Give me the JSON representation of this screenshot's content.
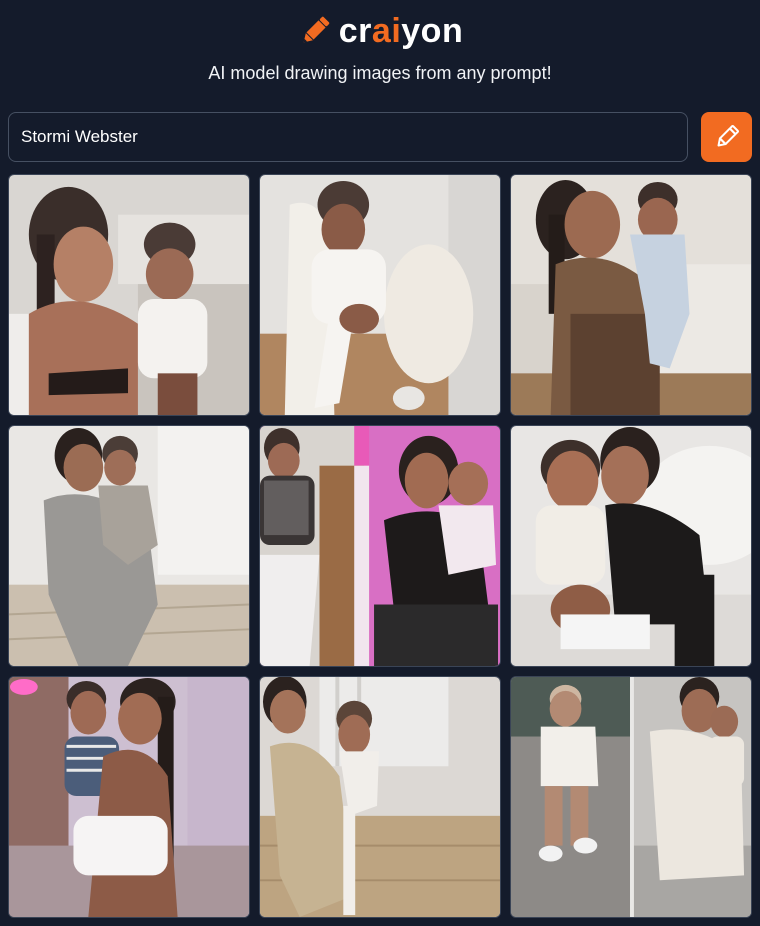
{
  "brand": {
    "logo_prefix": "cr",
    "logo_ai": "ai",
    "logo_suffix": "yon",
    "tagline": "AI model drawing images from any prompt!",
    "accent_color": "#f26b21",
    "background_color": "#141b2b"
  },
  "search": {
    "value": "Stormi Webster",
    "button_icon": "pencil-icon"
  },
  "results": {
    "count": 9,
    "images": [
      {
        "label": "woman with long ponytail holding toddler in white t-shirt on sofa"
      },
      {
        "label": "toddler in white outfit sitting in white chair"
      },
      {
        "label": "woman in brown outfit holding child in light blue onesie"
      },
      {
        "label": "woman in grey knit dress holding toddler on wooden floor"
      },
      {
        "label": "split image of toddler in sequin dress and woman in black top holding baby, pink background"
      },
      {
        "label": "woman in black top sitting on bed with toddler"
      },
      {
        "label": "woman in white holding toddler in striped shirt, pink light"
      },
      {
        "label": "woman in metallic gold dress with toddler"
      },
      {
        "label": "split image of toddler in white dress and woman in white holding child"
      }
    ]
  }
}
